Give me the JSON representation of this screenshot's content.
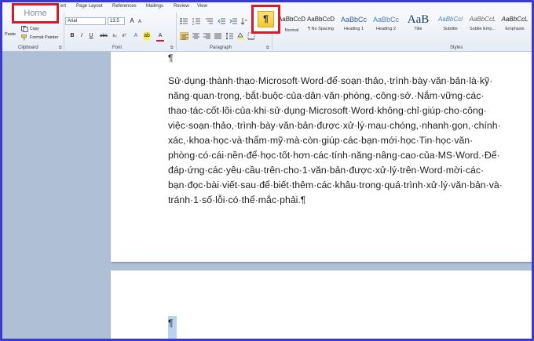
{
  "tabs": [
    {
      "id": "home",
      "label": "Home"
    },
    {
      "id": "insert",
      "label": "ert"
    },
    {
      "id": "page-layout",
      "label": "Page Layout"
    },
    {
      "id": "references",
      "label": "References"
    },
    {
      "id": "mailings",
      "label": "Mailings"
    },
    {
      "id": "review",
      "label": "Review"
    },
    {
      "id": "view",
      "label": "View"
    }
  ],
  "clipboard": {
    "paste_label": "Paste",
    "copy_label": "Copy",
    "format_painter_label": "Format Painter",
    "group_label": "Clipboard"
  },
  "font": {
    "family": "Arial",
    "size": "13.5",
    "group_label": "Font"
  },
  "paragraph": {
    "group_label": "Paragraph",
    "show_marks_glyph": "¶"
  },
  "styles": {
    "group_label": "Styles",
    "items": [
      {
        "sample": "AaBbCcD",
        "name": "Normal"
      },
      {
        "sample": "AaBbCcD",
        "name": "¶ No Spacing"
      },
      {
        "sample": "AaBbCc",
        "name": "Heading 1"
      },
      {
        "sample": "AaBbCc",
        "name": "Heading 2"
      },
      {
        "sample": "AaB",
        "name": "Title"
      },
      {
        "sample": "AaBbCcl",
        "name": "Subtitle"
      },
      {
        "sample": "AaBbCcL",
        "name": "Subtle Emp..."
      },
      {
        "sample": "AaBbCcL",
        "name": "Emphasis"
      }
    ]
  },
  "document": {
    "top_mark": "¶",
    "body_text": "Sử·dụng·thành·thạo·Microsoft·Word·để·soạn·thảo,·trình·bày·văn·bản·là·kỹ· năng·quan·trọng,·bắt·buộc·của·dân·văn·phòng,·công·sở.·Nắm·vững·các· thao·tác·cốt·lõi·của·khi·sử·dụng·Microsoft·Word·không·chỉ·giúp·cho·công· việc·soạn·thảo,·trình·bày·văn·bản·được·xử·lý·mau·chóng,·nhanh·gọn,·chính· xác,·khoa·học·và·thẩm·mỹ·mà·còn·giúp·các·bạn·mới·học·Tin·học·văn· phòng·có·cái·nền·để·học·tốt·hơn·các·tính·năng·nâng·cao·của·MS·Word.·Để· đáp·ứng·các·yêu·cầu·trên·cho·1·văn·bản·được·xử·lý·trên·Word·mời·các· bạn·đọc·bài·viết·sau·để·biết·thêm·các·khâu·trong·quá·trình·xử·lý·văn·bản·và· tránh·1·số·lỗi·có·thể·mắc·phải.¶",
    "page2_mark": "¶"
  },
  "colors": {
    "highlight_red": "#d21c2a",
    "frame_blue": "#3a3ad0",
    "toggle_yellow": "#f7c534"
  }
}
